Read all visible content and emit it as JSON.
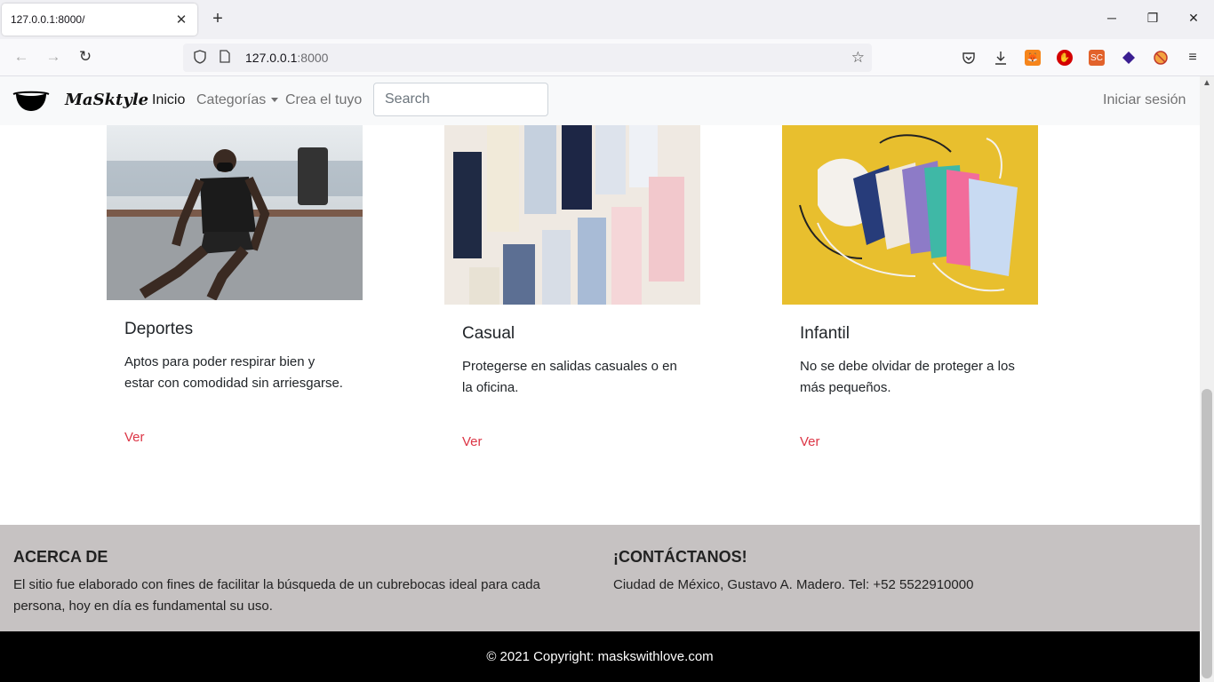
{
  "browser": {
    "tab_title": "127.0.0.1:8000/",
    "tab_close": "✕",
    "new_tab": "+",
    "url_host": "127.0.0.1",
    "url_port": ":8000",
    "icons": [
      "back-icon",
      "forward-icon",
      "reload-icon",
      "shield-icon",
      "page-icon",
      "star-icon",
      "pocket-icon",
      "download-icon",
      "metamask-icon",
      "ublock-icon",
      "sc-icon",
      "diamond-icon",
      "extension-icon",
      "menu-icon"
    ],
    "ext_sc_label": "SC",
    "accent": "#e2622b"
  },
  "nav": {
    "brand": "MaSktyle",
    "links": {
      "inicio": "Inicio",
      "categorias": "Categorías",
      "crea": "Crea el tuyo"
    },
    "search_placeholder": "Search",
    "login": "Iniciar sesión"
  },
  "cards": [
    {
      "title": "Deportes",
      "text": "Aptos para poder respirar bien y estar con comodidad sin arriesgarse.",
      "link": "Ver"
    },
    {
      "title": "Casual",
      "text": "Protegerse en salidas casuales o en la oficina.",
      "link": "Ver"
    },
    {
      "title": "Infantil",
      "text": "No se debe olvidar de proteger a los más pequeños.",
      "link": "Ver"
    }
  ],
  "footer": {
    "about_title": "ACERCA DE",
    "about_text": "El sitio fue elaborado con fines de facilitar la búsqueda de un cubrebocas ideal para cada persona, hoy en día es fundamental su uso.",
    "contact_title": "¡CONTÁCTANOS!",
    "contact_text": "Ciudad de México, Gustavo A. Madero. Tel: +52 5522910000",
    "copyright": "© 2021 Copyright: maskswithlove.com"
  },
  "colors": {
    "link_red": "#dc3545",
    "footer_bg": "#c6c2c2",
    "copyright_bg": "#000000",
    "card2_bg": "#efe9e2",
    "card3_bg": "#e8bf2e"
  }
}
